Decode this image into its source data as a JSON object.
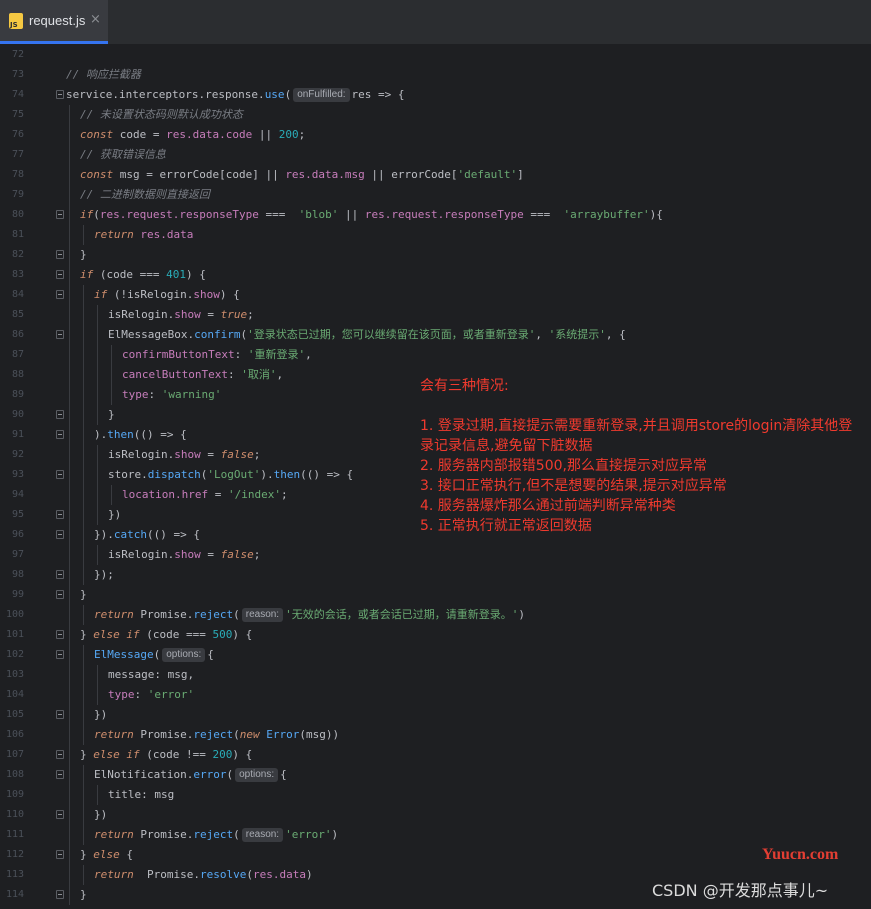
{
  "tab": {
    "filename": "request.js",
    "close_glyph": "×",
    "icon": "js-file-icon"
  },
  "lines": [
    {
      "n": "72",
      "indent": 0,
      "fold": false,
      "tokens": []
    },
    {
      "n": "73",
      "indent": 0,
      "fold": false,
      "tokens": [
        {
          "c": "cm",
          "t": "// 响应拦截器"
        }
      ]
    },
    {
      "n": "74",
      "indent": 0,
      "fold": true,
      "tokens": [
        {
          "c": "plain",
          "t": "service.interceptors.response."
        },
        {
          "c": "fn",
          "t": "use"
        },
        {
          "c": "plain",
          "t": "("
        },
        {
          "c": "hint",
          "t": "onFulfilled:"
        },
        {
          "c": "plain",
          "t": "res => {"
        }
      ]
    },
    {
      "n": "75",
      "indent": 1,
      "fold": false,
      "tokens": [
        {
          "c": "cm",
          "t": "// 未设置状态码则默认成功状态"
        }
      ]
    },
    {
      "n": "76",
      "indent": 1,
      "fold": false,
      "tokens": [
        {
          "c": "kw",
          "t": "const"
        },
        {
          "c": "plain",
          "t": " code = "
        },
        {
          "c": "pr",
          "t": "res.data.code"
        },
        {
          "c": "plain",
          "t": " || "
        },
        {
          "c": "num",
          "t": "200"
        },
        {
          "c": "plain",
          "t": ";"
        }
      ]
    },
    {
      "n": "77",
      "indent": 1,
      "fold": false,
      "tokens": [
        {
          "c": "cm",
          "t": "// 获取错误信息"
        }
      ]
    },
    {
      "n": "78",
      "indent": 1,
      "fold": false,
      "tokens": [
        {
          "c": "kw",
          "t": "const"
        },
        {
          "c": "plain",
          "t": " msg = errorCode[code] || "
        },
        {
          "c": "pr",
          "t": "res.data.msg"
        },
        {
          "c": "plain",
          "t": " || errorCode["
        },
        {
          "c": "str",
          "t": "'default'"
        },
        {
          "c": "plain",
          "t": "]"
        }
      ]
    },
    {
      "n": "79",
      "indent": 1,
      "fold": false,
      "tokens": [
        {
          "c": "cm",
          "t": "// 二进制数据则直接返回"
        }
      ]
    },
    {
      "n": "80",
      "indent": 1,
      "fold": true,
      "tokens": [
        {
          "c": "kw",
          "t": "if"
        },
        {
          "c": "plain",
          "t": "("
        },
        {
          "c": "pr",
          "t": "res.request.responseType"
        },
        {
          "c": "plain",
          "t": " ===  "
        },
        {
          "c": "str",
          "t": "'blob'"
        },
        {
          "c": "plain",
          "t": " || "
        },
        {
          "c": "pr",
          "t": "res.request.responseType"
        },
        {
          "c": "plain",
          "t": " ===  "
        },
        {
          "c": "str",
          "t": "'arraybuffer'"
        },
        {
          "c": "plain",
          "t": "){"
        }
      ]
    },
    {
      "n": "81",
      "indent": 2,
      "fold": false,
      "tokens": [
        {
          "c": "kw",
          "t": "return"
        },
        {
          "c": "plain",
          "t": " "
        },
        {
          "c": "pr",
          "t": "res.data"
        }
      ]
    },
    {
      "n": "82",
      "indent": 1,
      "fold": true,
      "tokens": [
        {
          "c": "plain",
          "t": "}"
        }
      ]
    },
    {
      "n": "83",
      "indent": 1,
      "fold": true,
      "tokens": [
        {
          "c": "kw",
          "t": "if"
        },
        {
          "c": "plain",
          "t": " (code === "
        },
        {
          "c": "num",
          "t": "401"
        },
        {
          "c": "plain",
          "t": ") {"
        }
      ]
    },
    {
      "n": "84",
      "indent": 2,
      "fold": true,
      "tokens": [
        {
          "c": "kw",
          "t": "if"
        },
        {
          "c": "plain",
          "t": " (!isRelogin."
        },
        {
          "c": "pr",
          "t": "show"
        },
        {
          "c": "plain",
          "t": ") {"
        }
      ]
    },
    {
      "n": "85",
      "indent": 3,
      "fold": false,
      "tokens": [
        {
          "c": "plain",
          "t": "isRelogin."
        },
        {
          "c": "pr",
          "t": "show"
        },
        {
          "c": "plain",
          "t": " = "
        },
        {
          "c": "kw",
          "t": "true"
        },
        {
          "c": "plain",
          "t": ";"
        }
      ]
    },
    {
      "n": "86",
      "indent": 3,
      "fold": true,
      "tokens": [
        {
          "c": "plain",
          "t": "ElMessageBox."
        },
        {
          "c": "fn",
          "t": "confirm"
        },
        {
          "c": "plain",
          "t": "("
        },
        {
          "c": "str",
          "t": "'登录状态已过期，您可以继续留在该页面，或者重新登录'"
        },
        {
          "c": "plain",
          "t": ", "
        },
        {
          "c": "str",
          "t": "'系统提示'"
        },
        {
          "c": "plain",
          "t": ", {"
        }
      ]
    },
    {
      "n": "87",
      "indent": 4,
      "fold": false,
      "tokens": [
        {
          "c": "pr",
          "t": "confirmButtonText"
        },
        {
          "c": "plain",
          "t": ": "
        },
        {
          "c": "str",
          "t": "'重新登录'"
        },
        {
          "c": "plain",
          "t": ","
        }
      ]
    },
    {
      "n": "88",
      "indent": 4,
      "fold": false,
      "tokens": [
        {
          "c": "pr",
          "t": "cancelButtonText"
        },
        {
          "c": "plain",
          "t": ": "
        },
        {
          "c": "str",
          "t": "'取消'"
        },
        {
          "c": "plain",
          "t": ","
        }
      ]
    },
    {
      "n": "89",
      "indent": 4,
      "fold": false,
      "tokens": [
        {
          "c": "pr",
          "t": "type"
        },
        {
          "c": "plain",
          "t": ": "
        },
        {
          "c": "str",
          "t": "'warning'"
        }
      ]
    },
    {
      "n": "90",
      "indent": 3,
      "fold": true,
      "tokens": [
        {
          "c": "plain",
          "t": "}"
        }
      ]
    },
    {
      "n": "91",
      "indent": 2,
      "fold": true,
      "tokens": [
        {
          "c": "plain",
          "t": ")."
        },
        {
          "c": "fn",
          "t": "then"
        },
        {
          "c": "plain",
          "t": "(() => {"
        }
      ]
    },
    {
      "n": "92",
      "indent": 3,
      "fold": false,
      "tokens": [
        {
          "c": "plain",
          "t": "isRelogin."
        },
        {
          "c": "pr",
          "t": "show"
        },
        {
          "c": "plain",
          "t": " = "
        },
        {
          "c": "kw",
          "t": "false"
        },
        {
          "c": "plain",
          "t": ";"
        }
      ]
    },
    {
      "n": "93",
      "indent": 3,
      "fold": true,
      "tokens": [
        {
          "c": "plain",
          "t": "store."
        },
        {
          "c": "fn",
          "t": "dispatch"
        },
        {
          "c": "plain",
          "t": "("
        },
        {
          "c": "str",
          "t": "'LogOut'"
        },
        {
          "c": "plain",
          "t": ")."
        },
        {
          "c": "fn",
          "t": "then"
        },
        {
          "c": "plain",
          "t": "(() => {"
        }
      ]
    },
    {
      "n": "94",
      "indent": 4,
      "fold": false,
      "tokens": [
        {
          "c": "pr",
          "t": "location.href"
        },
        {
          "c": "plain",
          "t": " = "
        },
        {
          "c": "str",
          "t": "'/index'"
        },
        {
          "c": "plain",
          "t": ";"
        }
      ]
    },
    {
      "n": "95",
      "indent": 3,
      "fold": true,
      "tokens": [
        {
          "c": "plain",
          "t": "})"
        }
      ]
    },
    {
      "n": "96",
      "indent": 2,
      "fold": true,
      "tokens": [
        {
          "c": "plain",
          "t": "})."
        },
        {
          "c": "fn",
          "t": "catch"
        },
        {
          "c": "plain",
          "t": "(() => {"
        }
      ]
    },
    {
      "n": "97",
      "indent": 3,
      "fold": false,
      "tokens": [
        {
          "c": "plain",
          "t": "isRelogin."
        },
        {
          "c": "pr",
          "t": "show"
        },
        {
          "c": "plain",
          "t": " = "
        },
        {
          "c": "kw",
          "t": "false"
        },
        {
          "c": "plain",
          "t": ";"
        }
      ]
    },
    {
      "n": "98",
      "indent": 2,
      "fold": true,
      "tokens": [
        {
          "c": "plain",
          "t": "});"
        }
      ]
    },
    {
      "n": "99",
      "indent": 1,
      "fold": true,
      "tokens": [
        {
          "c": "plain",
          "t": "}"
        }
      ]
    },
    {
      "n": "100",
      "indent": 2,
      "fold": false,
      "tokens": [
        {
          "c": "kw",
          "t": "return"
        },
        {
          "c": "plain",
          "t": " Promise."
        },
        {
          "c": "fn",
          "t": "reject"
        },
        {
          "c": "plain",
          "t": "("
        },
        {
          "c": "hint",
          "t": "reason:"
        },
        {
          "c": "str",
          "t": "'无效的会话，或者会话已过期，请重新登录。'"
        },
        {
          "c": "plain",
          "t": ")"
        }
      ]
    },
    {
      "n": "101",
      "indent": 1,
      "fold": true,
      "tokens": [
        {
          "c": "plain",
          "t": "} "
        },
        {
          "c": "kw",
          "t": "else if"
        },
        {
          "c": "plain",
          "t": " (code === "
        },
        {
          "c": "num",
          "t": "500"
        },
        {
          "c": "plain",
          "t": ") {"
        }
      ]
    },
    {
      "n": "102",
      "indent": 2,
      "fold": true,
      "tokens": [
        {
          "c": "fn",
          "t": "ElMessage"
        },
        {
          "c": "plain",
          "t": "("
        },
        {
          "c": "hint",
          "t": "options:"
        },
        {
          "c": "plain",
          "t": "{"
        }
      ]
    },
    {
      "n": "103",
      "indent": 3,
      "fold": false,
      "tokens": [
        {
          "c": "plain",
          "t": "message: msg,"
        }
      ]
    },
    {
      "n": "104",
      "indent": 3,
      "fold": false,
      "tokens": [
        {
          "c": "pr",
          "t": "type"
        },
        {
          "c": "plain",
          "t": ": "
        },
        {
          "c": "str",
          "t": "'error'"
        }
      ]
    },
    {
      "n": "105",
      "indent": 2,
      "fold": true,
      "tokens": [
        {
          "c": "plain",
          "t": "})"
        }
      ]
    },
    {
      "n": "106",
      "indent": 2,
      "fold": false,
      "tokens": [
        {
          "c": "kw",
          "t": "return"
        },
        {
          "c": "plain",
          "t": " Promise."
        },
        {
          "c": "fn",
          "t": "reject"
        },
        {
          "c": "plain",
          "t": "("
        },
        {
          "c": "kw",
          "t": "new"
        },
        {
          "c": "plain",
          "t": " "
        },
        {
          "c": "tp",
          "t": "Error"
        },
        {
          "c": "plain",
          "t": "(msg))"
        }
      ]
    },
    {
      "n": "107",
      "indent": 1,
      "fold": true,
      "tokens": [
        {
          "c": "plain",
          "t": "} "
        },
        {
          "c": "kw",
          "t": "else if"
        },
        {
          "c": "plain",
          "t": " (code !== "
        },
        {
          "c": "num",
          "t": "200"
        },
        {
          "c": "plain",
          "t": ") {"
        }
      ]
    },
    {
      "n": "108",
      "indent": 2,
      "fold": true,
      "tokens": [
        {
          "c": "plain",
          "t": "ElNotification."
        },
        {
          "c": "fn",
          "t": "error"
        },
        {
          "c": "plain",
          "t": "("
        },
        {
          "c": "hint",
          "t": "options:"
        },
        {
          "c": "plain",
          "t": "{"
        }
      ]
    },
    {
      "n": "109",
      "indent": 3,
      "fold": false,
      "tokens": [
        {
          "c": "plain",
          "t": "title: msg"
        }
      ]
    },
    {
      "n": "110",
      "indent": 2,
      "fold": true,
      "tokens": [
        {
          "c": "plain",
          "t": "})"
        }
      ]
    },
    {
      "n": "111",
      "indent": 2,
      "fold": false,
      "tokens": [
        {
          "c": "kw",
          "t": "return"
        },
        {
          "c": "plain",
          "t": " Promise."
        },
        {
          "c": "fn",
          "t": "reject"
        },
        {
          "c": "plain",
          "t": "("
        },
        {
          "c": "hint",
          "t": "reason:"
        },
        {
          "c": "str",
          "t": "'error'"
        },
        {
          "c": "plain",
          "t": ")"
        }
      ]
    },
    {
      "n": "112",
      "indent": 1,
      "fold": true,
      "tokens": [
        {
          "c": "plain",
          "t": "} "
        },
        {
          "c": "kw",
          "t": "else"
        },
        {
          "c": "plain",
          "t": " {"
        }
      ]
    },
    {
      "n": "113",
      "indent": 2,
      "fold": false,
      "tokens": [
        {
          "c": "kw",
          "t": "return"
        },
        {
          "c": "plain",
          "t": "  Promise."
        },
        {
          "c": "fn",
          "t": "resolve"
        },
        {
          "c": "plain",
          "t": "("
        },
        {
          "c": "pr",
          "t": "res.data"
        },
        {
          "c": "plain",
          "t": ")"
        }
      ]
    },
    {
      "n": "114",
      "indent": 1,
      "fold": true,
      "tokens": [
        {
          "c": "plain",
          "t": "}"
        }
      ]
    }
  ],
  "annotation": {
    "title": "会有三种情况:",
    "items": [
      "1. 登录过期,直接提示需要重新登录,并且调用store的login清除其他登录记录信息,避免留下脏数据",
      "2. 服务器内部报错500,那么直接提示对应异常",
      "3. 接口正常执行,但不是想要的结果,提示对应异常",
      "4. 服务器爆炸那么通过前端判断异常种类",
      "5. 正常执行就正常返回数据"
    ]
  },
  "watermarks": {
    "site": "Yuucn.com",
    "author": "CSDN @开发那点事儿~"
  }
}
